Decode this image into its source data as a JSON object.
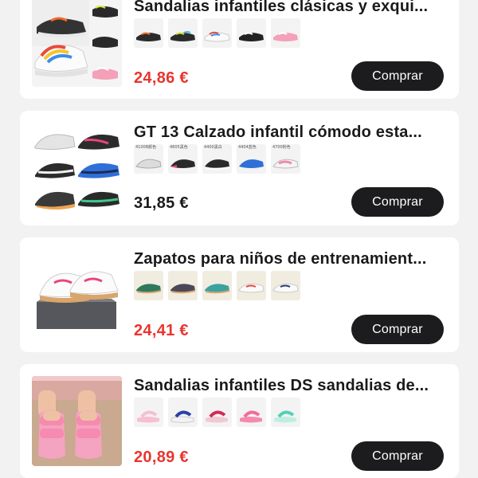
{
  "colors": {
    "price_red": "#e8352e",
    "price_dark": "#1a1a1a",
    "button_bg": "#1c1c1e",
    "card_bg": "#ffffff",
    "page_bg": "#f2f2f2"
  },
  "products": [
    {
      "title": "Sandalias infantiles clásicas y exqui...",
      "price": "24,86 €",
      "price_color": "red",
      "buy_label": "Comprar",
      "image_icon": "sandal-sneaker-collage-icon",
      "thumbs": [
        {
          "icon": "black-sandal-icon",
          "label": ""
        },
        {
          "icon": "black-yellow-sandal-icon",
          "label": ""
        },
        {
          "icon": "white-rainbow-sandal-icon",
          "label": ""
        },
        {
          "icon": "black-sandal-icon",
          "label": ""
        },
        {
          "icon": "pink-sandal-icon",
          "label": ""
        }
      ]
    },
    {
      "title": "GT 13 Calzado infantil cómodo esta...",
      "price": "31,85 €",
      "price_color": "dark",
      "buy_label": "Comprar",
      "image_icon": "sneaker-grid-icon",
      "thumbs": [
        {
          "icon": "grey-sneaker-icon",
          "label": "4100B颜色"
        },
        {
          "icon": "black-pink-sneaker-icon",
          "label": "4805黑色"
        },
        {
          "icon": "black-white-sneaker-icon",
          "label": "4400黑白"
        },
        {
          "icon": "blue-sneaker-icon",
          "label": "4404蓝色"
        },
        {
          "icon": "pink-white-sneaker-icon",
          "label": "4700粉色"
        }
      ]
    },
    {
      "title": "Zapatos para niños de entrenamient...",
      "price": "24,41 €",
      "price_color": "red",
      "buy_label": "Comprar",
      "image_icon": "white-trainer-on-box-icon",
      "thumbs": [
        {
          "icon": "green-trainer-icon",
          "label": ""
        },
        {
          "icon": "navy-trainer-icon",
          "label": ""
        },
        {
          "icon": "teal-trainer-icon",
          "label": ""
        },
        {
          "icon": "white-red-trainer-icon",
          "label": ""
        },
        {
          "icon": "white-navy-trainer-icon",
          "label": ""
        }
      ]
    },
    {
      "title": "Sandalias infantiles DS sandalias de...",
      "price": "20,89 €",
      "price_color": "red",
      "buy_label": "Comprar",
      "image_icon": "pink-slide-sandal-photo-icon",
      "thumbs": [
        {
          "icon": "light-pink-sandal-icon",
          "label": ""
        },
        {
          "icon": "blue-sandal-icon",
          "label": ""
        },
        {
          "icon": "red-sandal-icon",
          "label": ""
        },
        {
          "icon": "pink-sandal-icon",
          "label": ""
        },
        {
          "icon": "mint-sandal-icon",
          "label": ""
        }
      ]
    }
  ]
}
